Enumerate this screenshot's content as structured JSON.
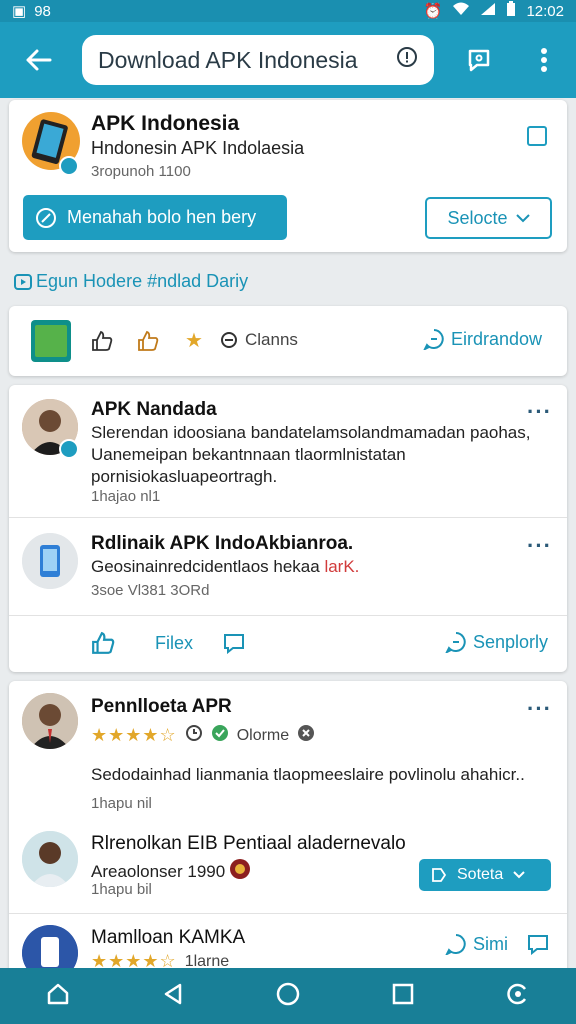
{
  "status_bar": {
    "time": "12:02",
    "left_text": "98"
  },
  "search": {
    "query": "Download APK Indonesia"
  },
  "profile": {
    "name": "APK Indonesia",
    "subtitle": "Hndonesin APK Indolaesia",
    "meta": "3ropunoh 1100",
    "primary_button": "Menahah bolo hen bery",
    "secondary_button": "Selocte"
  },
  "section_header": "Egun Hodere  #ndlad Dariy",
  "action_strip": {
    "claims": "Clanns",
    "right_action": "Eirdrandow"
  },
  "post_card": {
    "items": [
      {
        "title": "APK Nandada",
        "body": "Slerendan idoosiana bandatelamsolandmamadan paohas, Uanemeipan bekantnnaan tlaormlnistatan pornisiokasluapeortragh.",
        "meta": "1hajao nl1"
      },
      {
        "title": "Rdlinaik APK IndoAkbianroa.",
        "body_plain": "Geosinainredcidentlaos hekaa ",
        "body_red": "larK.",
        "meta": "3soe Vl381 3ORd"
      }
    ],
    "footer": {
      "files": "Filex",
      "reply": "Senplorly"
    }
  },
  "review_card": {
    "items": [
      {
        "title": "Pennlloeta APR",
        "online": "Olorme",
        "body": "Sedodainhad lianmania tlaopmeeslaire povlinolu ahahicr..",
        "meta": "1hapu nil"
      },
      {
        "title": "Rlrenolkan EIB Pentiaal aladernevalo",
        "sub": "Areaolonser 1990",
        "meta": "1hapu bil",
        "button": "Soteta"
      },
      {
        "title": "Mamlloan KAMKA",
        "online": "1larne",
        "action": "Simi"
      }
    ]
  },
  "colors": {
    "accent": "#1e9dc0",
    "nav": "#187f97",
    "star": "#e2a72a"
  }
}
